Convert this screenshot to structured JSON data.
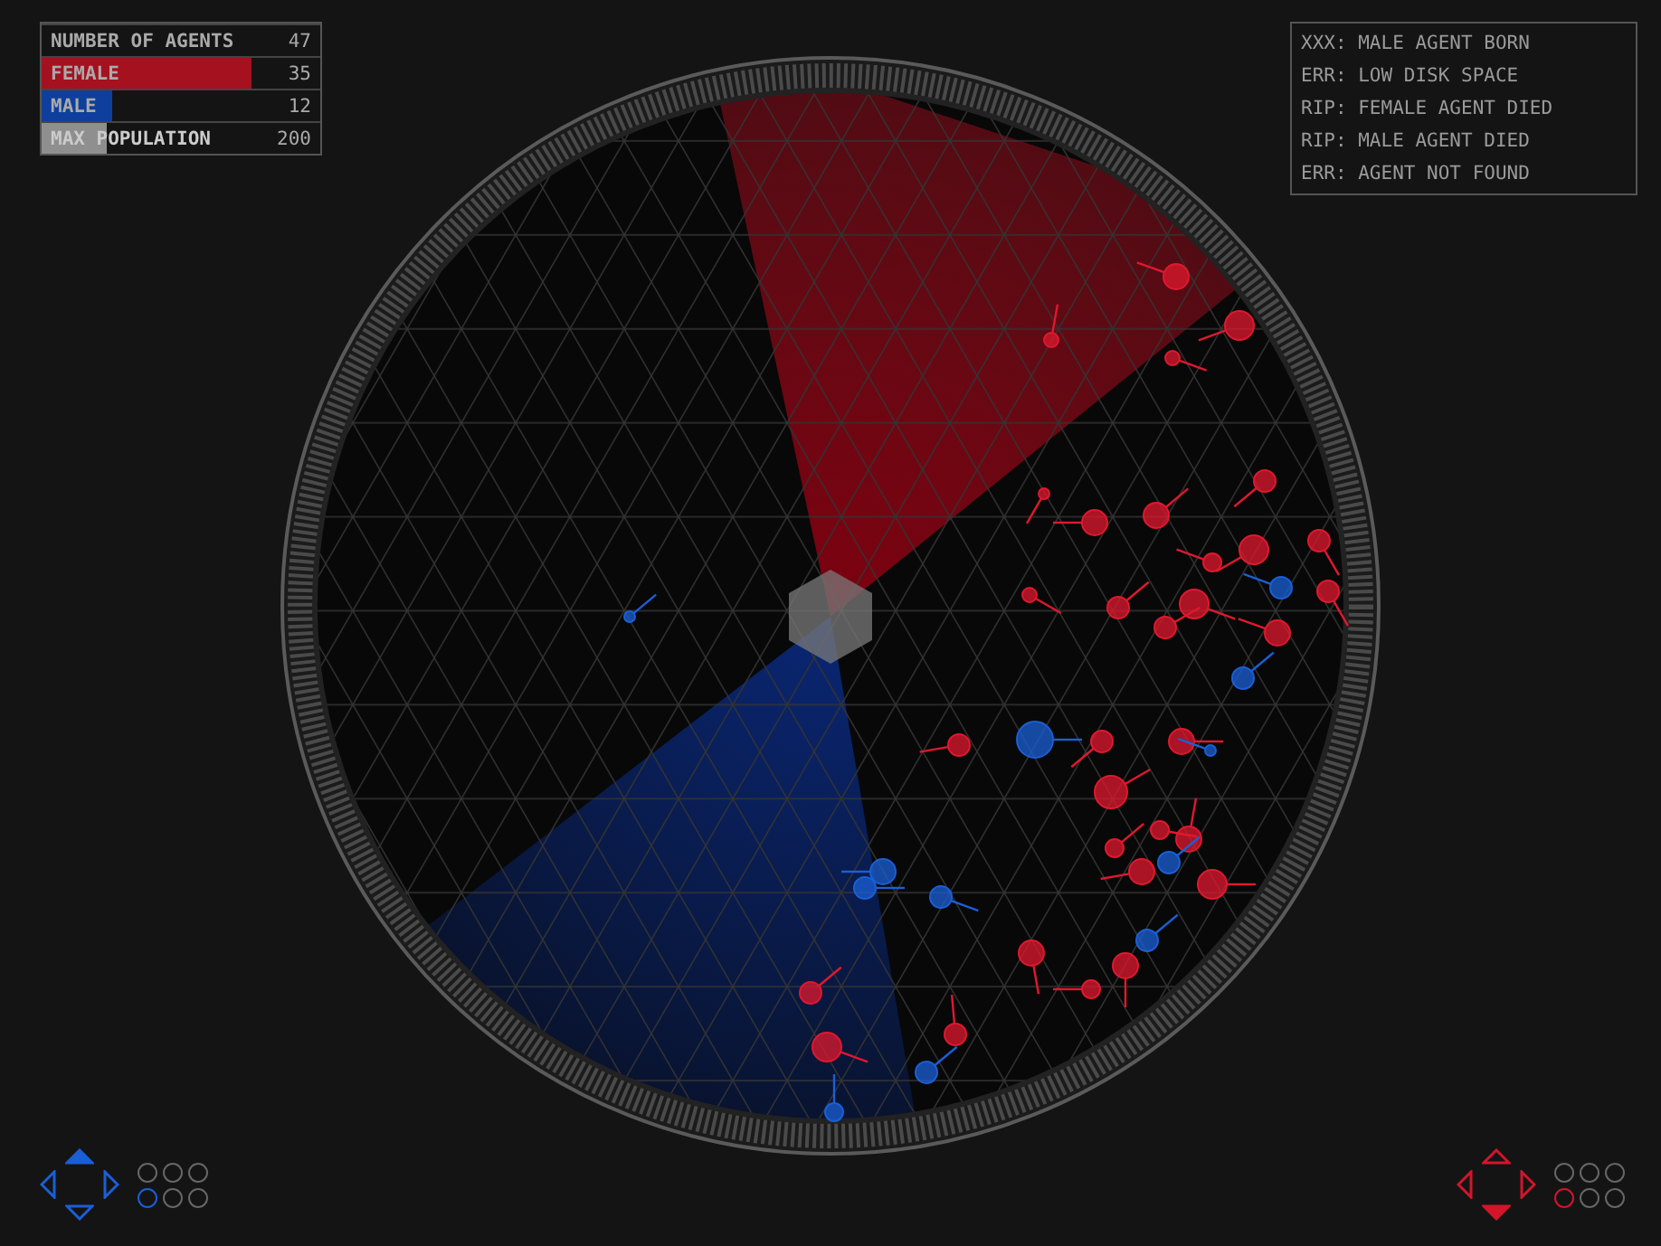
{
  "stats": [
    {
      "label": "NUMBER OF AGENTS",
      "value": "47",
      "kind": "plain"
    },
    {
      "label": "FEMALE",
      "value": "35",
      "kind": "female",
      "level": 0.75
    },
    {
      "label": "MALE",
      "value": "12",
      "kind": "male",
      "level": 0.25
    },
    {
      "label": "MAX POPULATION",
      "value": "200",
      "kind": "limit",
      "level": 0.235
    }
  ],
  "log": [
    "XXX: MALE AGENT BORN",
    "ERR: LOW DISK SPACE",
    "RIP: FEMALE AGENT DIED",
    "RIP: MALE AGENT DIED",
    "ERR: AGENT NOT FOUND"
  ],
  "controllers": [
    {
      "color": "#1a5fd6",
      "buttons": [
        {
          "kind": "up",
          "pressed": true
        },
        {
          "kind": "left",
          "pressed": false
        },
        {
          "kind": "right",
          "pressed": false
        },
        {
          "kind": "down",
          "pressed": false
        }
      ],
      "slots": [
        {
          "selected": false
        },
        {
          "selected": false
        },
        {
          "selected": false
        },
        {
          "selected": true
        },
        {
          "selected": false
        },
        {
          "selected": false
        }
      ]
    },
    {
      "color": "#d3152a",
      "buttons": [
        {
          "kind": "up",
          "pressed": false
        },
        {
          "kind": "left",
          "pressed": false
        },
        {
          "kind": "right",
          "pressed": false
        },
        {
          "kind": "down",
          "pressed": true
        }
      ],
      "slots": [
        {
          "selected": false
        },
        {
          "selected": false
        },
        {
          "selected": false
        },
        {
          "selected": true
        },
        {
          "selected": false
        },
        {
          "selected": false
        }
      ]
    }
  ]
}
